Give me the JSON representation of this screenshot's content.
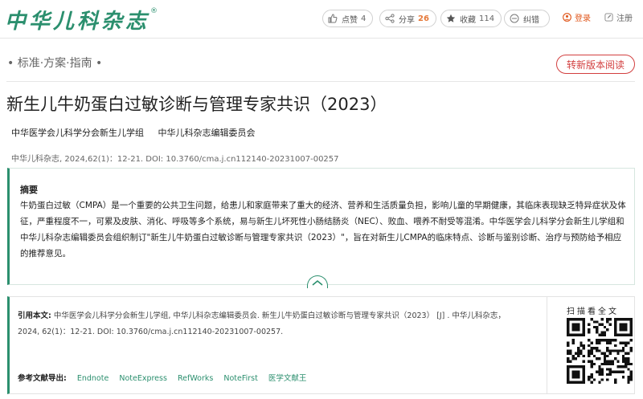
{
  "header": {
    "logo_text": "中华儿科杂志",
    "logo_mark": "®",
    "tools": [
      {
        "name": "like",
        "label": "点赞",
        "count": "4"
      },
      {
        "name": "share",
        "label": "分享",
        "count": "26"
      },
      {
        "name": "favorite",
        "label": "收藏",
        "count": "114"
      },
      {
        "name": "correct",
        "label": "纠错",
        "count": ""
      }
    ],
    "login_label": "登录",
    "register_label": "注册"
  },
  "section_label": "• 标准·方案·指南 •",
  "read_new_label": "转新版本阅读",
  "article": {
    "title": "新生儿牛奶蛋白过敏诊断与管理专家共识（2023）",
    "authors": [
      "中华医学会儿科学分会新生儿学组",
      "中华儿科杂志编辑委员会"
    ],
    "journal_line": "中华儿科杂志, 2024,62(1)：12-21. DOI: 10.3760/cma.j.cn112140-20231007-00257"
  },
  "abstract": {
    "heading": "摘要",
    "text": "牛奶蛋白过敏（CMPA）是一个重要的公共卫生问题，给患儿和家庭带来了重大的经济、营养和生活质量负担，影响儿童的早期健康，其临床表现缺乏特异症状及体征，严重程度不一，可累及皮肤、消化、呼吸等多个系统，易与新生儿坏死性小肠结肠炎（NEC）、败血、喂养不耐受等混淆。中华医学会儿科学分会新生儿学组和中华儿科杂志编辑委员会组织制订\"新生儿牛奶蛋白过敏诊断与管理专家共识（2023）\"，旨在对新生儿CMPA的临床特点、诊断与鉴别诊断、治疗与预防给予相应的推荐意见。"
  },
  "citation": {
    "label": "引用本文:",
    "text": "中华医学会儿科学分会新生儿学组, 中华儿科杂志编辑委员会. 新生儿牛奶蛋白过敏诊断与管理专家共识（2023） [J] . 中华儿科杂志，2024, 62(1)：12-21. DOI: 10.3760/cma.j.cn112140-20231007-00257.",
    "export_label": "参考文献导出:",
    "export_links": [
      "Endnote",
      "NoteExpress",
      "RefWorks",
      "NoteFirst",
      "医学文献王"
    ],
    "qr_label": "扫描看全文"
  },
  "colors": {
    "brand_green": "#2b8f6e",
    "accent_red": "#d23f3f",
    "count_orange": "#e5793a"
  },
  "icons": [
    "thumbs-up-icon",
    "share-icon",
    "star-icon",
    "correct-icon",
    "user-icon",
    "edit-icon",
    "chevron-up-icon",
    "qr-code-icon"
  ]
}
